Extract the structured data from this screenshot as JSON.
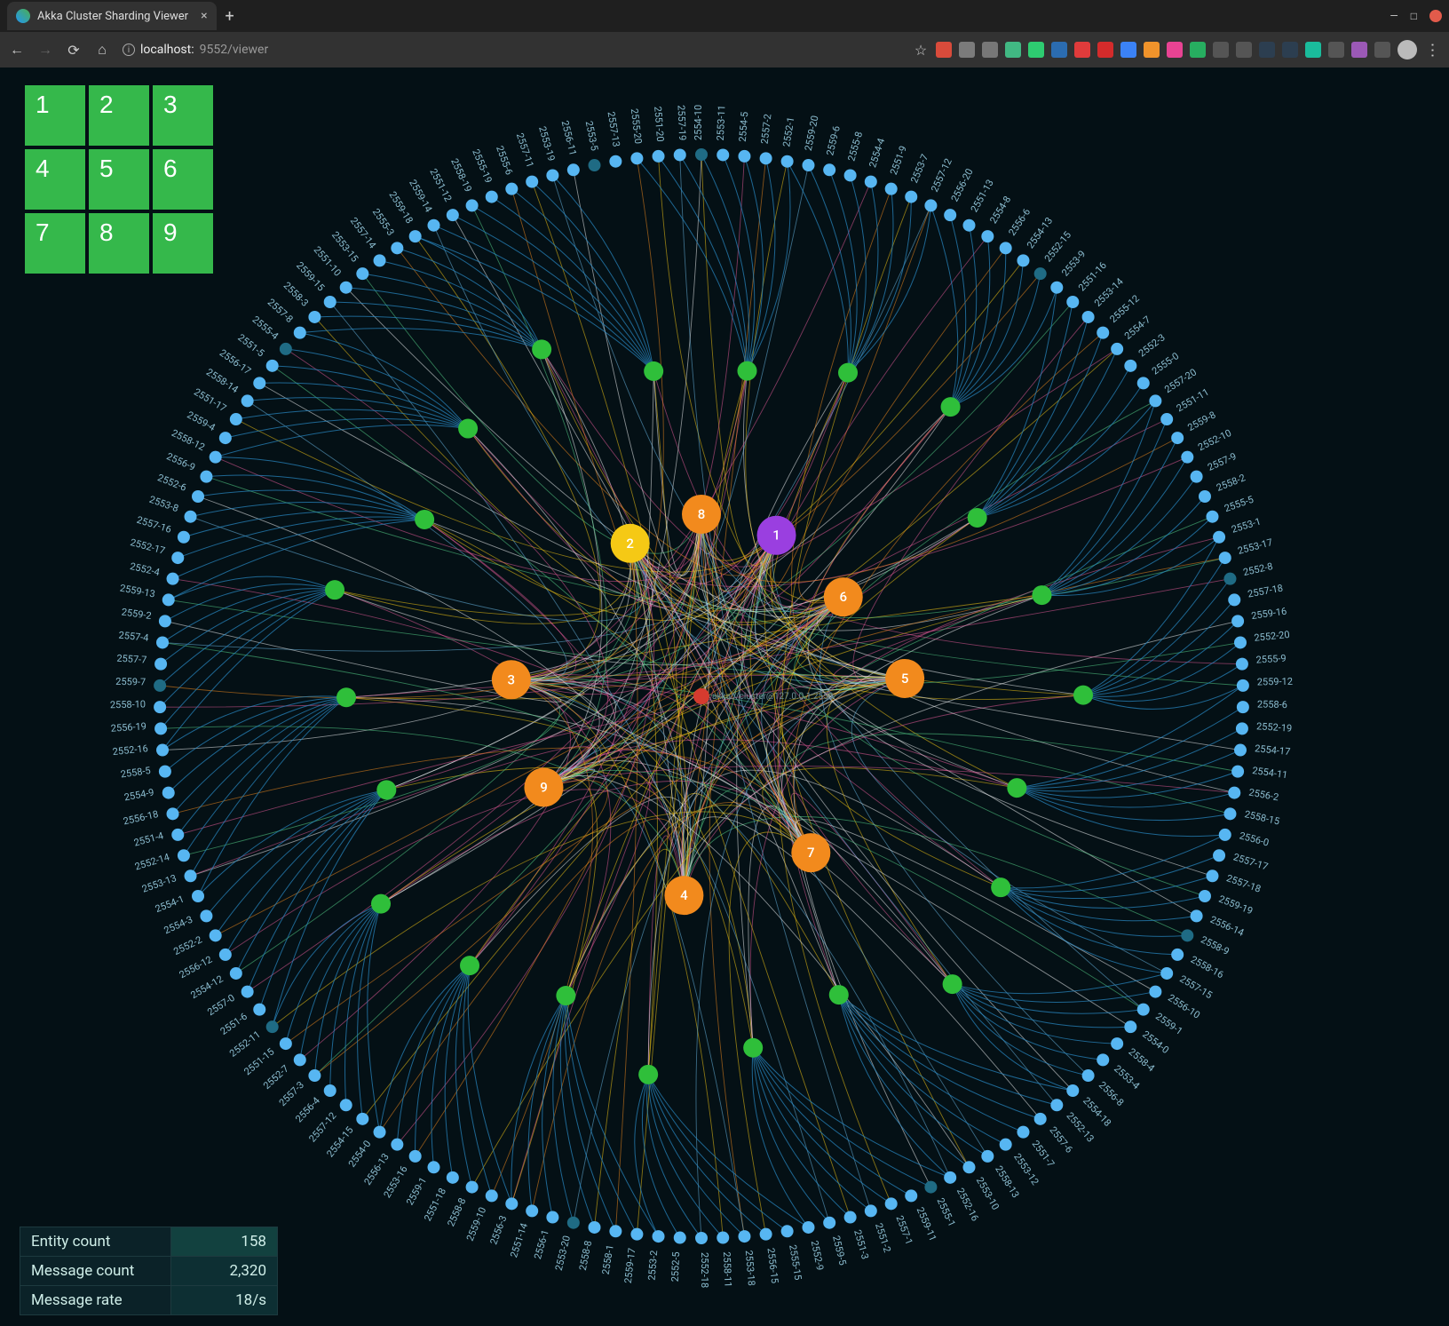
{
  "browser": {
    "tab_title": "Akka Cluster Sharding Viewer",
    "url_host": "localhost:",
    "url_port_path": "9552/viewer"
  },
  "pad": [
    "1",
    "2",
    "3",
    "4",
    "5",
    "6",
    "7",
    "8",
    "9"
  ],
  "stats": [
    {
      "label": "Entity count",
      "value": "158",
      "hi": true
    },
    {
      "label": "Message count",
      "value": "2,320",
      "hi": false
    },
    {
      "label": "Message rate",
      "value": "18/s",
      "hi": false
    }
  ],
  "viz": {
    "center": {
      "label": "akka://cluster@127.0.0.1:2558"
    },
    "hubs": [
      {
        "id": "1",
        "color": "#9a3fe0",
        "angle": -65,
        "r": 200
      },
      {
        "id": "2",
        "color": "#f5c915",
        "angle": -115,
        "r": 190
      },
      {
        "id": "3",
        "color": "#f28a1d",
        "angle": -175,
        "r": 215
      },
      {
        "id": "4",
        "color": "#f28a1d",
        "angle": 95,
        "r": 225
      },
      {
        "id": "5",
        "color": "#f28a1d",
        "angle": -5,
        "r": 230
      },
      {
        "id": "6",
        "color": "#f28a1d",
        "angle": -35,
        "r": 195
      },
      {
        "id": "7",
        "color": "#f28a1d",
        "angle": 55,
        "r": 215
      },
      {
        "id": "8",
        "color": "#f28a1d",
        "angle": -90,
        "r": 205
      },
      {
        "id": "9",
        "color": "#f28a1d",
        "angle": 150,
        "r": 205
      }
    ],
    "mid_count": 22,
    "outer": [
      "2554-10",
      "2553-11",
      "2554-5",
      "2557-2",
      "2552-1",
      "2559-20",
      "2559-6",
      "2555-8",
      "2554-4",
      "2551-9",
      "2553-7",
      "2557-12",
      "2556-20",
      "2551-13",
      "2554-8",
      "2556-6",
      "2554-13",
      "2552-15",
      "2553-9",
      "2551-16",
      "2553-14",
      "2555-12",
      "2554-7",
      "2552-3",
      "2555-0",
      "2557-20",
      "2551-11",
      "2559-8",
      "2552-10",
      "2557-9",
      "2558-2",
      "2555-5",
      "2553-1",
      "2553-17",
      "2552-8",
      "2557-18",
      "2559-16",
      "2552-20",
      "2555-9",
      "2559-12",
      "2558-6",
      "2552-19",
      "2554-17",
      "2554-11",
      "2556-2",
      "2558-15",
      "2556-0",
      "2557-17",
      "2557-18",
      "2559-19",
      "2556-14",
      "2558-9",
      "2558-16",
      "2557-15",
      "2556-10",
      "2559-1",
      "2554-0",
      "2558-4",
      "2553-4",
      "2556-8",
      "2554-18",
      "2552-13",
      "2557-6",
      "2551-7",
      "2553-12",
      "2558-13",
      "2553-10",
      "2552-16",
      "2555-1",
      "2559-11",
      "2557-1",
      "2551-2",
      "2551-3",
      "2559-5",
      "2552-9",
      "2555-15",
      "2556-15",
      "2553-18",
      "2558-11",
      "2552-18",
      "2552-5",
      "2553-2",
      "2559-17",
      "2558-1",
      "2558-8",
      "2553-20",
      "2556-1",
      "2551-14",
      "2556-3",
      "2559-10",
      "2558-8",
      "2551-18",
      "2559-1",
      "2553-16",
      "2556-13",
      "2554-0",
      "2554-15",
      "2557-12",
      "2556-4",
      "2557-3",
      "2552-7",
      "2551-15",
      "2552-11",
      "2551-6",
      "2557-0",
      "2554-12",
      "2556-12",
      "2552-2",
      "2554-3",
      "2554-1",
      "2553-13",
      "2552-14",
      "2551-4",
      "2556-18",
      "2554-9",
      "2558-5",
      "2552-16",
      "2556-19",
      "2558-10",
      "2559-7",
      "2557-7",
      "2557-4",
      "2559-2",
      "2559-13",
      "2552-4",
      "2552-17",
      "2557-16",
      "2553-8",
      "2552-6",
      "2556-9",
      "2558-12",
      "2559-4",
      "2551-17",
      "2558-14",
      "2556-17",
      "2551-5",
      "2555-4",
      "2557-8",
      "2558-3",
      "2559-15",
      "2551-10",
      "2553-15",
      "2557-14",
      "2555-3",
      "2559-18",
      "2559-14",
      "2551-12",
      "2558-19",
      "2555-19",
      "2555-6",
      "2557-11",
      "2553-19",
      "2556-11",
      "2553-5",
      "2557-13",
      "2555-20",
      "2551-20",
      "2557-19"
    ],
    "mesh_colors": [
      "#f5c915",
      "#f28a1d",
      "#e85b9b",
      "#58d68d",
      "#f0f3f4",
      "#6ab8e6"
    ]
  },
  "ext_colors": [
    "#d94b3b",
    "#7b7b7b",
    "#777",
    "#41b883",
    "#2ecc71",
    "#2b6cb0",
    "#e03b3b",
    "#d42b2b",
    "#3b82f6",
    "#f0932b",
    "#e84393",
    "#27ae60",
    "#555",
    "#555",
    "#2c3e50",
    "#2c3e50",
    "#1abc9c",
    "#555",
    "#9b59b6",
    "#555"
  ]
}
